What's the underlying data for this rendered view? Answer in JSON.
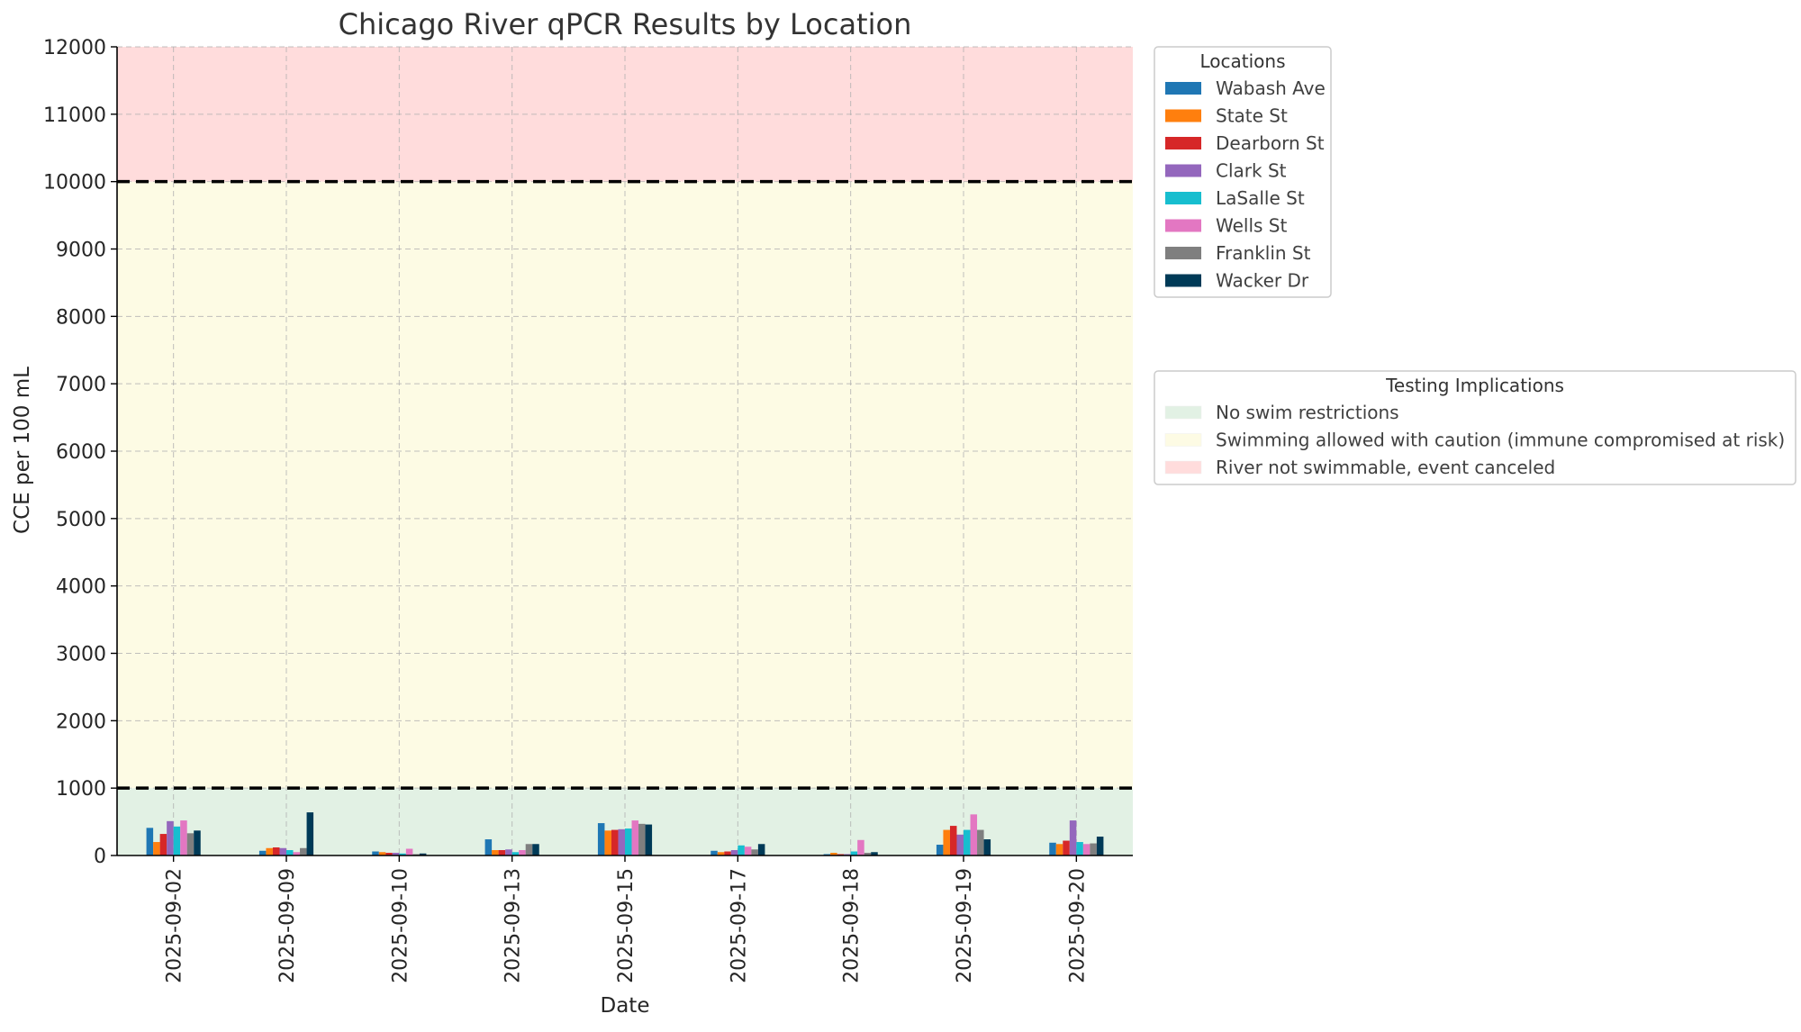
{
  "chart_data": {
    "type": "bar",
    "title": "Chicago River qPCR Results by Location",
    "xlabel": "Date",
    "ylabel": "CCE per 100 mL",
    "ylim": [
      0,
      12000
    ],
    "yticks": [
      0,
      1000,
      2000,
      3000,
      4000,
      5000,
      6000,
      7000,
      8000,
      9000,
      10000,
      11000,
      12000
    ],
    "grid": true,
    "categories": [
      "2025-09-02",
      "2025-09-09",
      "2025-09-10",
      "2025-09-13",
      "2025-09-15",
      "2025-09-17",
      "2025-09-18",
      "2025-09-19",
      "2025-09-20"
    ],
    "series": [
      {
        "name": "Wabash Ave",
        "color": "#1f77b4",
        "values": [
          410,
          70,
          60,
          240,
          480,
          70,
          20,
          160,
          190
        ]
      },
      {
        "name": "State St",
        "color": "#ff7f0e",
        "values": [
          200,
          110,
          50,
          80,
          370,
          50,
          40,
          380,
          170
        ]
      },
      {
        "name": "Dearborn St",
        "color": "#d62728",
        "values": [
          320,
          120,
          40,
          80,
          380,
          60,
          20,
          440,
          220
        ]
      },
      {
        "name": "Clark St",
        "color": "#9467bd",
        "values": [
          510,
          110,
          40,
          90,
          390,
          80,
          20,
          310,
          520
        ]
      },
      {
        "name": "LaSalle St",
        "color": "#17becf",
        "values": [
          430,
          80,
          30,
          50,
          400,
          150,
          60,
          380,
          200
        ]
      },
      {
        "name": "Wells St",
        "color": "#e377c2",
        "values": [
          520,
          50,
          100,
          80,
          520,
          130,
          230,
          610,
          170
        ]
      },
      {
        "name": "Franklin St",
        "color": "#7f7f7f",
        "values": [
          330,
          110,
          20,
          170,
          470,
          90,
          40,
          380,
          180
        ]
      },
      {
        "name": "Wacker Dr",
        "color": "#003a57",
        "values": [
          370,
          640,
          30,
          170,
          460,
          170,
          50,
          240,
          280
        ]
      }
    ],
    "zones": [
      {
        "label": "No swim restrictions",
        "from": 0,
        "to": 1000,
        "color": "#e2f1e4"
      },
      {
        "label": "Swimming allowed with caution (immune compromised at risk)",
        "from": 1000,
        "to": 10000,
        "color": "#fdfbe4"
      },
      {
        "label": "River not swimmable, event canceled",
        "from": 10000,
        "to": 12000,
        "color": "#ffdcdc"
      }
    ],
    "threshold_lines": [
      1000,
      10000
    ],
    "legends": {
      "locations_title": "Locations",
      "locations_placement": "outside-top-right",
      "implications_title": "Testing Implications",
      "implications_placement": "outside-right"
    }
  }
}
